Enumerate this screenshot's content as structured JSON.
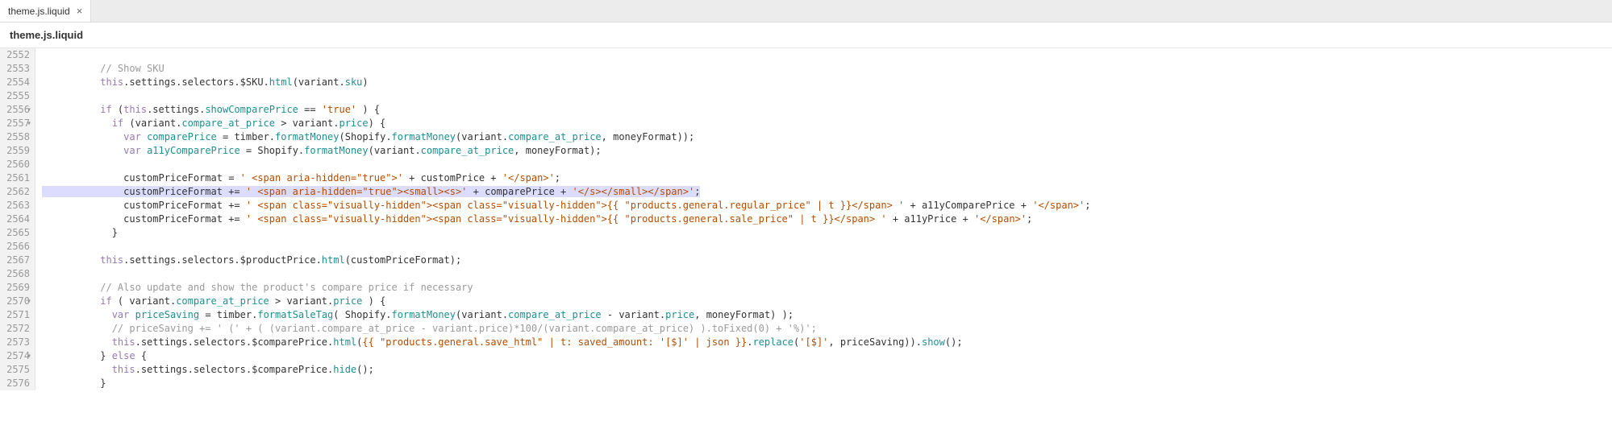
{
  "tab": {
    "name": "theme.js.liquid",
    "close": "×"
  },
  "file_title": "theme.js.liquid",
  "gutter": {
    "start": 2552,
    "end": 2576,
    "fold_lines": [
      2556,
      2557,
      2570,
      2574
    ]
  },
  "code": {
    "l2552": "",
    "l2553": "          // Show SKU",
    "l2554_a": "          ",
    "l2554_this": "this",
    "l2554_b": ".settings.selectors.$SKU.",
    "l2554_html": "html",
    "l2554_c": "(variant.",
    "l2554_sku": "sku",
    "l2554_d": ")",
    "l2555": "",
    "l2556_a": "          ",
    "l2556_if": "if",
    "l2556_b": " (",
    "l2556_this": "this",
    "l2556_c": ".settings.",
    "l2556_scp": "showComparePrice",
    "l2556_d": " == ",
    "l2556_true": "'true'",
    "l2556_e": " ) {",
    "l2557_a": "            ",
    "l2557_if": "if",
    "l2557_b": " (variant.",
    "l2557_cap": "compare_at_price",
    "l2557_c": " > variant.",
    "l2557_price": "price",
    "l2557_d": ") {",
    "l2558_a": "              ",
    "l2558_var": "var",
    "l2558_b": " ",
    "l2558_cp": "comparePrice",
    "l2558_c": " = timber.",
    "l2558_fm": "formatMoney",
    "l2558_d": "(Shopify.",
    "l2558_fm2": "formatMoney",
    "l2558_e": "(variant.",
    "l2558_cap": "compare_at_price",
    "l2558_f": ", moneyFormat));",
    "l2559_a": "              ",
    "l2559_var": "var",
    "l2559_b": " ",
    "l2559_acp": "a11yComparePrice",
    "l2559_c": " = Shopify.",
    "l2559_fm": "formatMoney",
    "l2559_d": "(variant.",
    "l2559_cap": "compare_at_price",
    "l2559_e": ", moneyFormat);",
    "l2560": "",
    "l2561_a": "              customPriceFormat = ",
    "l2561_s1": "' <span aria-hidden=\"true\">'",
    "l2561_b": " + customPrice + ",
    "l2561_s2": "'</span>'",
    "l2561_c": ";",
    "l2562_a": "              customPriceFormat += ",
    "l2562_s1": "' <span aria-hidden=\"true\"><small><s>'",
    "l2562_b": " + comparePrice + ",
    "l2562_s2": "'</s></small></span>'",
    "l2562_c": ";",
    "l2563_a": "              customPriceFormat += ",
    "l2563_s1": "' <span class=\"visually-hidden\"><span class=\"visually-hidden\">{{ \"products.general.regular_price\" | t }}</span> '",
    "l2563_b": " + a11yComparePrice + ",
    "l2563_s2": "'</span>'",
    "l2563_c": ";",
    "l2564_a": "              customPriceFormat += ",
    "l2564_s1": "' <span class=\"visually-hidden\"><span class=\"visually-hidden\">{{ \"products.general.sale_price\" | t }}</span> '",
    "l2564_b": " + a11yPrice + ",
    "l2564_s2": "'</span>'",
    "l2564_c": ";",
    "l2565": "            }",
    "l2566": "",
    "l2567_a": "          ",
    "l2567_this": "this",
    "l2567_b": ".settings.selectors.$productPrice.",
    "l2567_html": "html",
    "l2567_c": "(customPriceFormat);",
    "l2568": "",
    "l2569": "          // Also update and show the product's compare price if necessary",
    "l2570_a": "          ",
    "l2570_if": "if",
    "l2570_b": " ( variant.",
    "l2570_cap": "compare_at_price",
    "l2570_c": " > variant.",
    "l2570_price": "price",
    "l2570_d": " ) {",
    "l2571_a": "            ",
    "l2571_var": "var",
    "l2571_b": " ",
    "l2571_ps": "priceSaving",
    "l2571_c": " = timber.",
    "l2571_fst": "formatSaleTag",
    "l2571_d": "( Shopify.",
    "l2571_fm": "formatMoney",
    "l2571_e": "(variant.",
    "l2571_cap": "compare_at_price",
    "l2571_f": " - variant.",
    "l2571_price": "price",
    "l2571_g": ", moneyFormat) );",
    "l2572": "            // priceSaving += ' (' + ( (variant.compare_at_price - variant.price)*100/(variant.compare_at_price) ).toFixed(0) + '%)';",
    "l2573_a": "            ",
    "l2573_this": "this",
    "l2573_b": ".settings.selectors.$comparePrice.",
    "l2573_html": "html",
    "l2573_c": "(",
    "l2573_s1": "{{ \"products.general.save_html\" | t: saved_amount: '[$]' | json }}",
    "l2573_d": ".",
    "l2573_repl": "replace",
    "l2573_e": "(",
    "l2573_s2": "'[$]'",
    "l2573_f": ", priceSaving)).",
    "l2573_show": "show",
    "l2573_g": "();",
    "l2574_a": "          } ",
    "l2574_else": "else",
    "l2574_b": " {",
    "l2575_a": "            ",
    "l2575_this": "this",
    "l2575_b": ".settings.selectors.$comparePrice.",
    "l2575_hide": "hide",
    "l2575_c": "();",
    "l2576": "          }"
  }
}
